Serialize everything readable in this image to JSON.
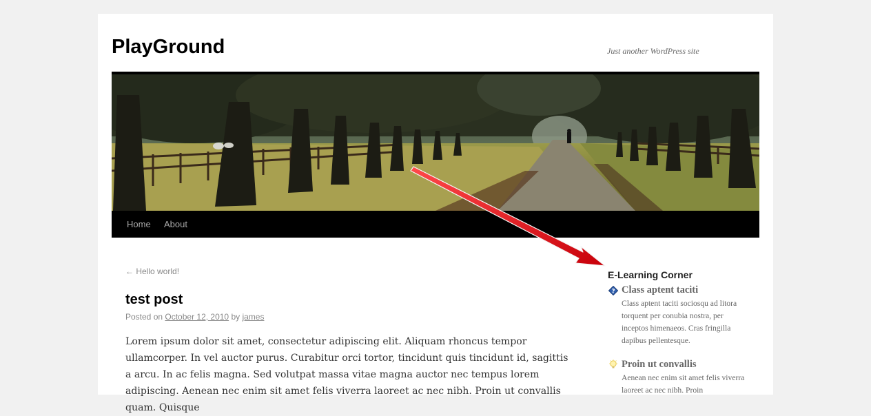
{
  "site": {
    "title": "PlayGround",
    "description": "Just another WordPress site"
  },
  "nav": {
    "items": [
      {
        "label": "Home"
      },
      {
        "label": "About"
      }
    ]
  },
  "post": {
    "prev_link": "← Hello world!",
    "title": "test post",
    "meta_prefix": "Posted on ",
    "date": "October 12, 2010",
    "meta_by": " by ",
    "author": "james",
    "body": "Lorem ipsum dolor sit amet, consectetur adipiscing elit. Aliquam rhoncus tempor ullamcorper. In vel auctor purus. Curabitur orci tortor, tincidunt quis tincidunt id, sagittis a arcu. In ac felis magna. Sed volutpat massa vitae magna auctor nec tempus lorem adipiscing. Aenean nec enim sit amet felis viverra laoreet ac nec nibh. Proin ut convallis quam. Quisque"
  },
  "sidebar": {
    "widget_title": "E-Learning Corner",
    "items": [
      {
        "icon": "blue-diamond-icon",
        "title": "Class aptent taciti",
        "text": "Class aptent taciti sociosqu ad litora torquent per conubia nostra, per inceptos himenaeos. Cras fringilla dapibus pellentesque."
      },
      {
        "icon": "lightbulb-icon",
        "title": "Proin ut convallis",
        "text": "Aenean nec enim sit amet felis viverra laoreet ac nec nibh. Proin"
      }
    ]
  },
  "colors": {
    "arrow": "#e8121a",
    "nav_bg": "#000000",
    "page_bg": "#f1f1f1"
  }
}
